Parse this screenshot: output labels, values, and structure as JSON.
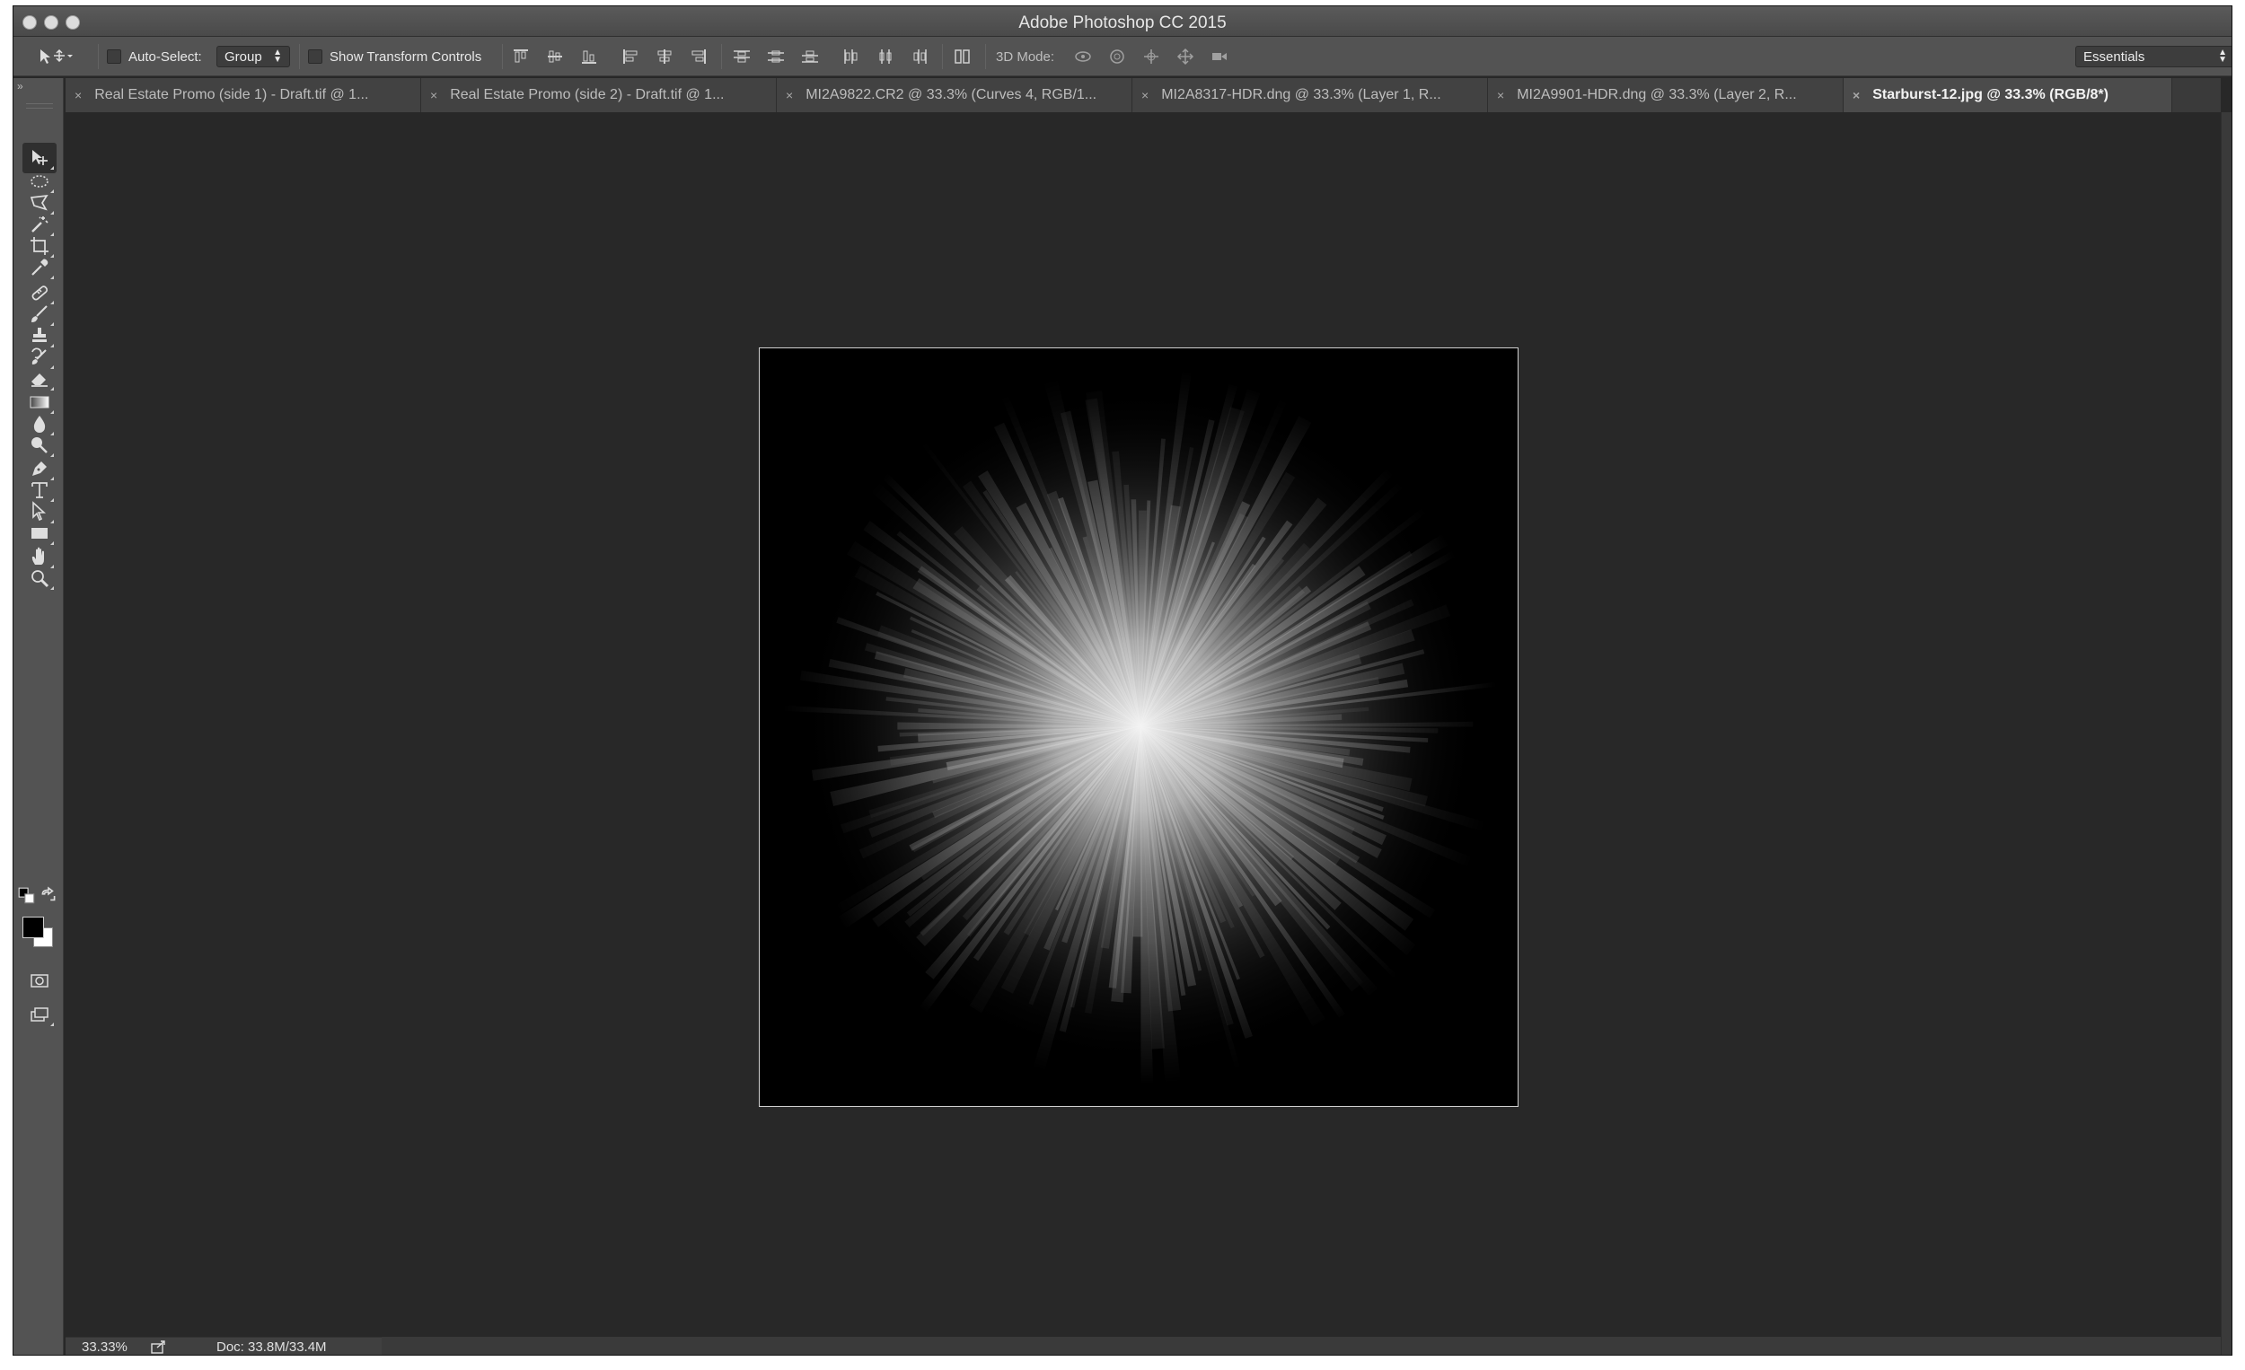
{
  "window": {
    "title": "Adobe Photoshop CC 2015"
  },
  "options_bar": {
    "auto_select_label": "Auto-Select:",
    "auto_select_value": "Group",
    "show_transform_label": "Show Transform Controls",
    "mode3d_label": "3D Mode:",
    "workspace_value": "Essentials"
  },
  "tabs": [
    {
      "label": "Real Estate Promo (side 1) - Draft.tif @ 1...",
      "active": false
    },
    {
      "label": "Real Estate Promo (side 2) - Draft.tif @ 1...",
      "active": false
    },
    {
      "label": "MI2A9822.CR2 @ 33.3% (Curves 4, RGB/1...",
      "active": false
    },
    {
      "label": "MI2A8317-HDR.dng @ 33.3% (Layer 1, R...",
      "active": false
    },
    {
      "label": "MI2A9901-HDR.dng @ 33.3% (Layer 2, R...",
      "active": false
    },
    {
      "label": "Starburst-12.jpg @ 33.3% (RGB/8*)",
      "active": true
    }
  ],
  "tab_close_glyph": "×",
  "tools": [
    {
      "name": "move-tool-icon",
      "active": true
    },
    {
      "name": "elliptical-marquee-tool-icon"
    },
    {
      "name": "polygonal-lasso-tool-icon"
    },
    {
      "name": "magic-wand-tool-icon"
    },
    {
      "name": "crop-tool-icon"
    },
    {
      "name": "eyedropper-tool-icon"
    },
    {
      "name": "healing-brush-tool-icon"
    },
    {
      "name": "brush-tool-icon"
    },
    {
      "name": "clone-stamp-tool-icon"
    },
    {
      "name": "history-brush-tool-icon"
    },
    {
      "name": "eraser-tool-icon"
    },
    {
      "name": "gradient-tool-icon"
    },
    {
      "name": "blur-tool-icon"
    },
    {
      "name": "dodge-tool-icon"
    },
    {
      "name": "pen-tool-icon"
    },
    {
      "name": "type-tool-icon"
    },
    {
      "name": "path-selection-tool-icon"
    },
    {
      "name": "rectangle-tool-icon"
    },
    {
      "name": "hand-tool-icon"
    },
    {
      "name": "zoom-tool-icon"
    }
  ],
  "colors": {
    "foreground": "#000000",
    "background": "#ffffff",
    "ui_dark": "#282828",
    "ui_panel": "#535353"
  },
  "status_bar": {
    "zoom": "33.33%",
    "doc_info": "Doc: 33.8M/33.4M"
  }
}
